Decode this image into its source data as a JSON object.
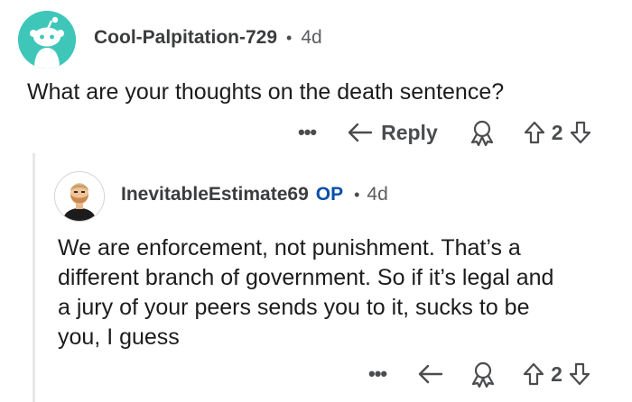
{
  "comment": {
    "username": "Cool-Palpitation-729",
    "separator": "•",
    "age": "4d",
    "body": "What are your thoughts on the death sentence?",
    "actions": {
      "more_label": "•••",
      "reply_label": "Reply",
      "vote_count": "2"
    }
  },
  "reply": {
    "username": "InevitableEstimate69",
    "op_badge": "OP",
    "separator": "•",
    "age": "4d",
    "body_lines": [
      "We are enforcement, not punishment. That’s a",
      "different branch of government. So if it’s legal and",
      "a jury of your peers sends you to it, sucks to be",
      "you, I guess"
    ],
    "actions": {
      "more_label": "•••",
      "vote_count": "2"
    }
  },
  "colors": {
    "snoo_background": "#3ec7b8",
    "op_badge": "#0a4fa8",
    "thread_line": "#e6e8ea"
  },
  "icons": [
    "snoo-avatar",
    "user-avatar",
    "reply-arrow-icon",
    "award-icon",
    "upvote-icon",
    "downvote-icon"
  ]
}
